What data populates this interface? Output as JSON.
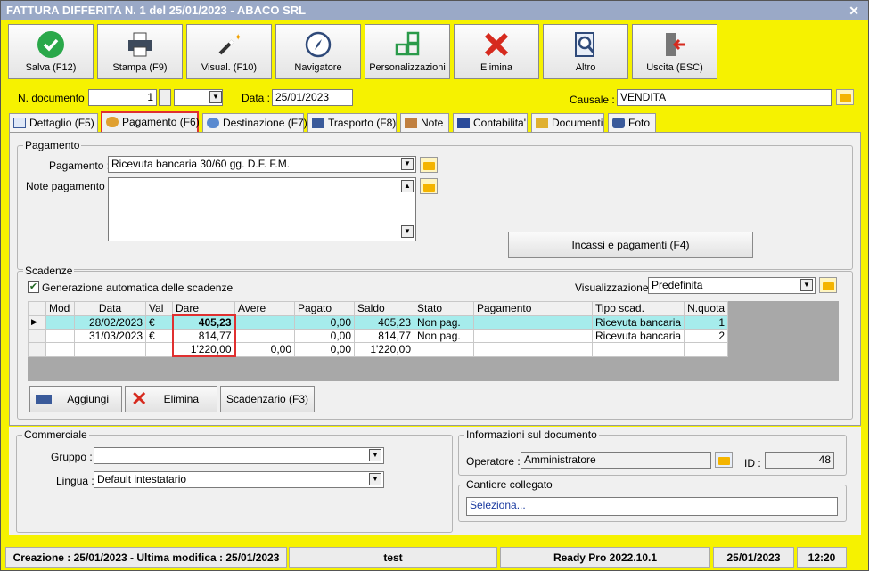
{
  "window": {
    "title": "FATTURA DIFFERITA N. 1 del 25/01/2023 - ABACO SRL",
    "close": "✕"
  },
  "toolbar": [
    {
      "label": "Salva (F12)",
      "icon": "check-icon"
    },
    {
      "label": "Stampa (F9)",
      "icon": "printer-icon"
    },
    {
      "label": "Visual. (F10)",
      "icon": "magic-wand-icon"
    },
    {
      "label": "Navigatore",
      "icon": "compass-icon"
    },
    {
      "label": "Personalizzazioni",
      "icon": "grid-icon"
    },
    {
      "label": "Elimina",
      "icon": "red-x-icon"
    },
    {
      "label": "Altro",
      "icon": "search-doc-icon"
    },
    {
      "label": "Uscita (ESC)",
      "icon": "exit-door-icon"
    }
  ],
  "header": {
    "ndoc_label": "N. documento :",
    "ndoc_value": "1",
    "data_label": "Data :",
    "data_value": "25/01/2023",
    "causale_label": "Causale :",
    "causale_value": "VENDITA"
  },
  "tabs": [
    {
      "label": "Dettaglio (F5)",
      "icon": "table-icon"
    },
    {
      "label": "Pagamento (F6)",
      "icon": "coins-icon"
    },
    {
      "label": "Destinazione (F7)",
      "icon": "globe-icon"
    },
    {
      "label": "Trasporto (F8)",
      "icon": "truck-icon"
    },
    {
      "label": "Note",
      "icon": "note-icon"
    },
    {
      "label": "Contabilita'",
      "icon": "book-icon"
    },
    {
      "label": "Documenti",
      "icon": "folder-icon"
    },
    {
      "label": "Foto",
      "icon": "camera-icon"
    }
  ],
  "pagamento": {
    "group_title": "Pagamento",
    "pag_label": "Pagamento :",
    "pag_value": "Ricevuta bancaria 30/60 gg. D.F. F.M.",
    "note_label": "Note pagamento :",
    "incassi_button": "Incassi e pagamenti (F4)"
  },
  "scadenze": {
    "group_title": "Scadenze",
    "auto_label": "Generazione automatica delle scadenze",
    "vis_label": "Visualizzazione :",
    "vis_value": "Predefinita",
    "columns": [
      "Mod",
      "Data",
      "Val",
      "Dare",
      "Avere",
      "Pagato",
      "Saldo",
      "Stato",
      "Pagamento",
      "Tipo scad.",
      "N.quota"
    ],
    "rows": [
      [
        "",
        "28/02/2023",
        "€",
        "405,23",
        "",
        "0,00",
        "405,23",
        "Non pag.",
        "",
        "Ricevuta bancaria",
        "1"
      ],
      [
        "",
        "31/03/2023",
        "€",
        "814,77",
        "",
        "0,00",
        "814,77",
        "Non pag.",
        "",
        "Ricevuta bancaria",
        "2"
      ]
    ],
    "totals": [
      "",
      "",
      "",
      "1'220,00",
      "0,00",
      "0,00",
      "1'220,00",
      "",
      "",
      "",
      ""
    ],
    "add_button": "Aggiungi",
    "delete_button": "Elimina",
    "scad_button": "Scadenzario (F3)"
  },
  "commerciale": {
    "group_title": "Commerciale",
    "gruppo_label": "Gruppo :",
    "gruppo_value": "",
    "lingua_label": "Lingua :",
    "lingua_value": "Default intestatario"
  },
  "info": {
    "group_title": "Informazioni sul documento",
    "operatore_label": "Operatore :",
    "operatore_value": "Amministratore",
    "id_label": "ID :",
    "id_value": "48"
  },
  "cantiere": {
    "group_title": "Cantiere collegato",
    "link": "Seleziona..."
  },
  "status": {
    "creation": "Creazione : 25/01/2023 - Ultima modifica : 25/01/2023",
    "user": "test",
    "version": "Ready Pro 2022.10.1",
    "date": "25/01/2023",
    "time": "12:20"
  }
}
